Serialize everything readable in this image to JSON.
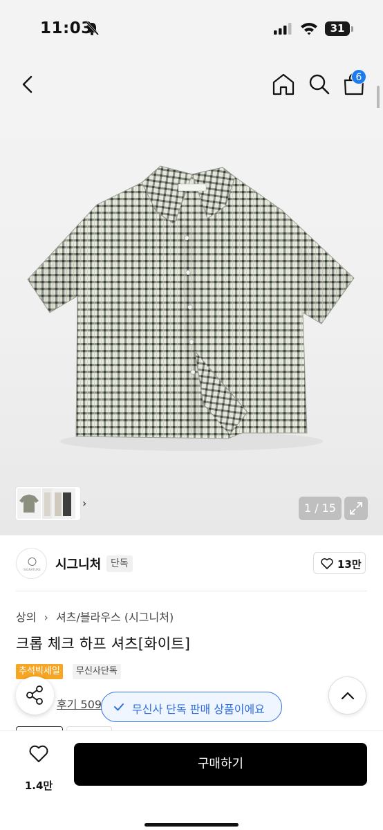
{
  "status_bar": {
    "time": "11:03",
    "battery": "31"
  },
  "header": {
    "cart_count": "6"
  },
  "gallery": {
    "counter": "1 / 15"
  },
  "brand": {
    "logo_text": "SIGNATURE",
    "name": "시그니처",
    "exclusive_label": "단독",
    "like_count": "13만"
  },
  "breadcrumb": {
    "items": [
      "상의",
      "셔츠/블라우스 (시그니처)"
    ]
  },
  "product": {
    "title": "크롭 체크 하프 셔츠[화이트]",
    "tags": [
      "추석빅세일",
      "무신사단독"
    ],
    "review_label": "후기 509"
  },
  "toast": {
    "text": "무신사 단독 판매 상품이에요"
  },
  "bottom_bar": {
    "wish_count": "1.4만",
    "buy_label": "구매하기"
  },
  "colors": {
    "accent": "#2f6fe0",
    "badge": "#1d7bf0",
    "sale": "#f6a623",
    "buy": "#000000"
  }
}
